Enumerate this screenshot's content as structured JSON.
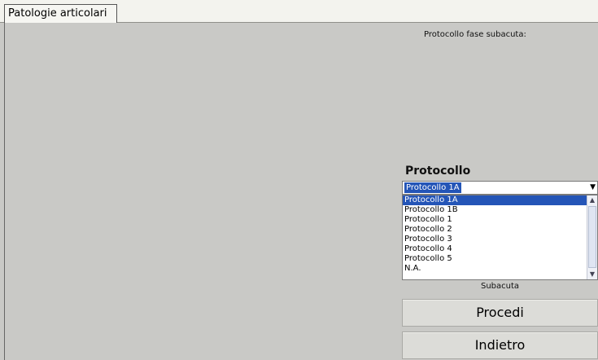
{
  "tabs": [
    {
      "label": "Patologie articolari"
    }
  ],
  "header": {
    "protocol_title": "Protocollo fase subacuta:"
  },
  "form": {
    "protocollo_label": "Protocollo",
    "combo_value": "Protocollo 1A",
    "options": [
      "Protocollo 1A",
      "Protocollo 1B",
      "Protocollo 1",
      "Protocollo 2",
      "Protocollo 3",
      "Protocollo 4",
      "Protocollo 5",
      "N.A."
    ],
    "selected_index": 0,
    "phase": "Subacuta"
  },
  "buttons": {
    "procedi": "Procedi",
    "indietro": "Indietro"
  },
  "colors": {
    "selection": "#2455b7",
    "background": "#c9c9c6"
  },
  "icons": {
    "combo_arrow": "chevron-down-icon",
    "scroll_up": "arrow-up-icon",
    "scroll_down": "arrow-down-icon"
  }
}
